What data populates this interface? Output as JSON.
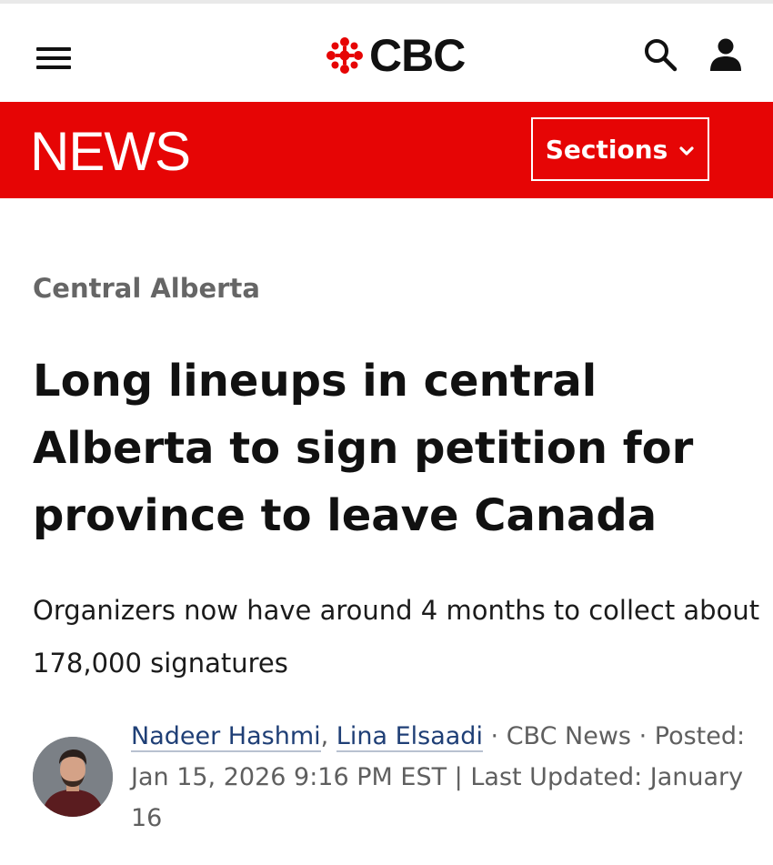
{
  "header": {
    "logo_text": "CBC"
  },
  "newsbar": {
    "title": "NEWS",
    "sections_label": "Sections"
  },
  "article": {
    "category": "Central Alberta",
    "headline": "Long lineups in central Alberta to sign petition for province to leave Canada",
    "deck": "Organizers now have around 4 months to collect about 178,000 signatures",
    "authors": [
      "Nadeer Hashmi",
      "Lina Elsaadi"
    ],
    "author_separator": ", ",
    "outlet": "CBC News",
    "dot": " · ",
    "posted": "Posted: Jan 15, 2026 9:16 PM EST",
    "pipe": " | ",
    "updated": "Last Updated: January 16"
  },
  "icons": {
    "menu": "hamburger-menu-icon",
    "search": "search-icon",
    "user": "user-account-icon",
    "chevron": "chevron-down-icon",
    "gem": "cbc-gem-logo-icon"
  },
  "colors": {
    "brand_red": "#e60505",
    "link_blue": "#1f3f76",
    "category_gray": "#666666"
  }
}
